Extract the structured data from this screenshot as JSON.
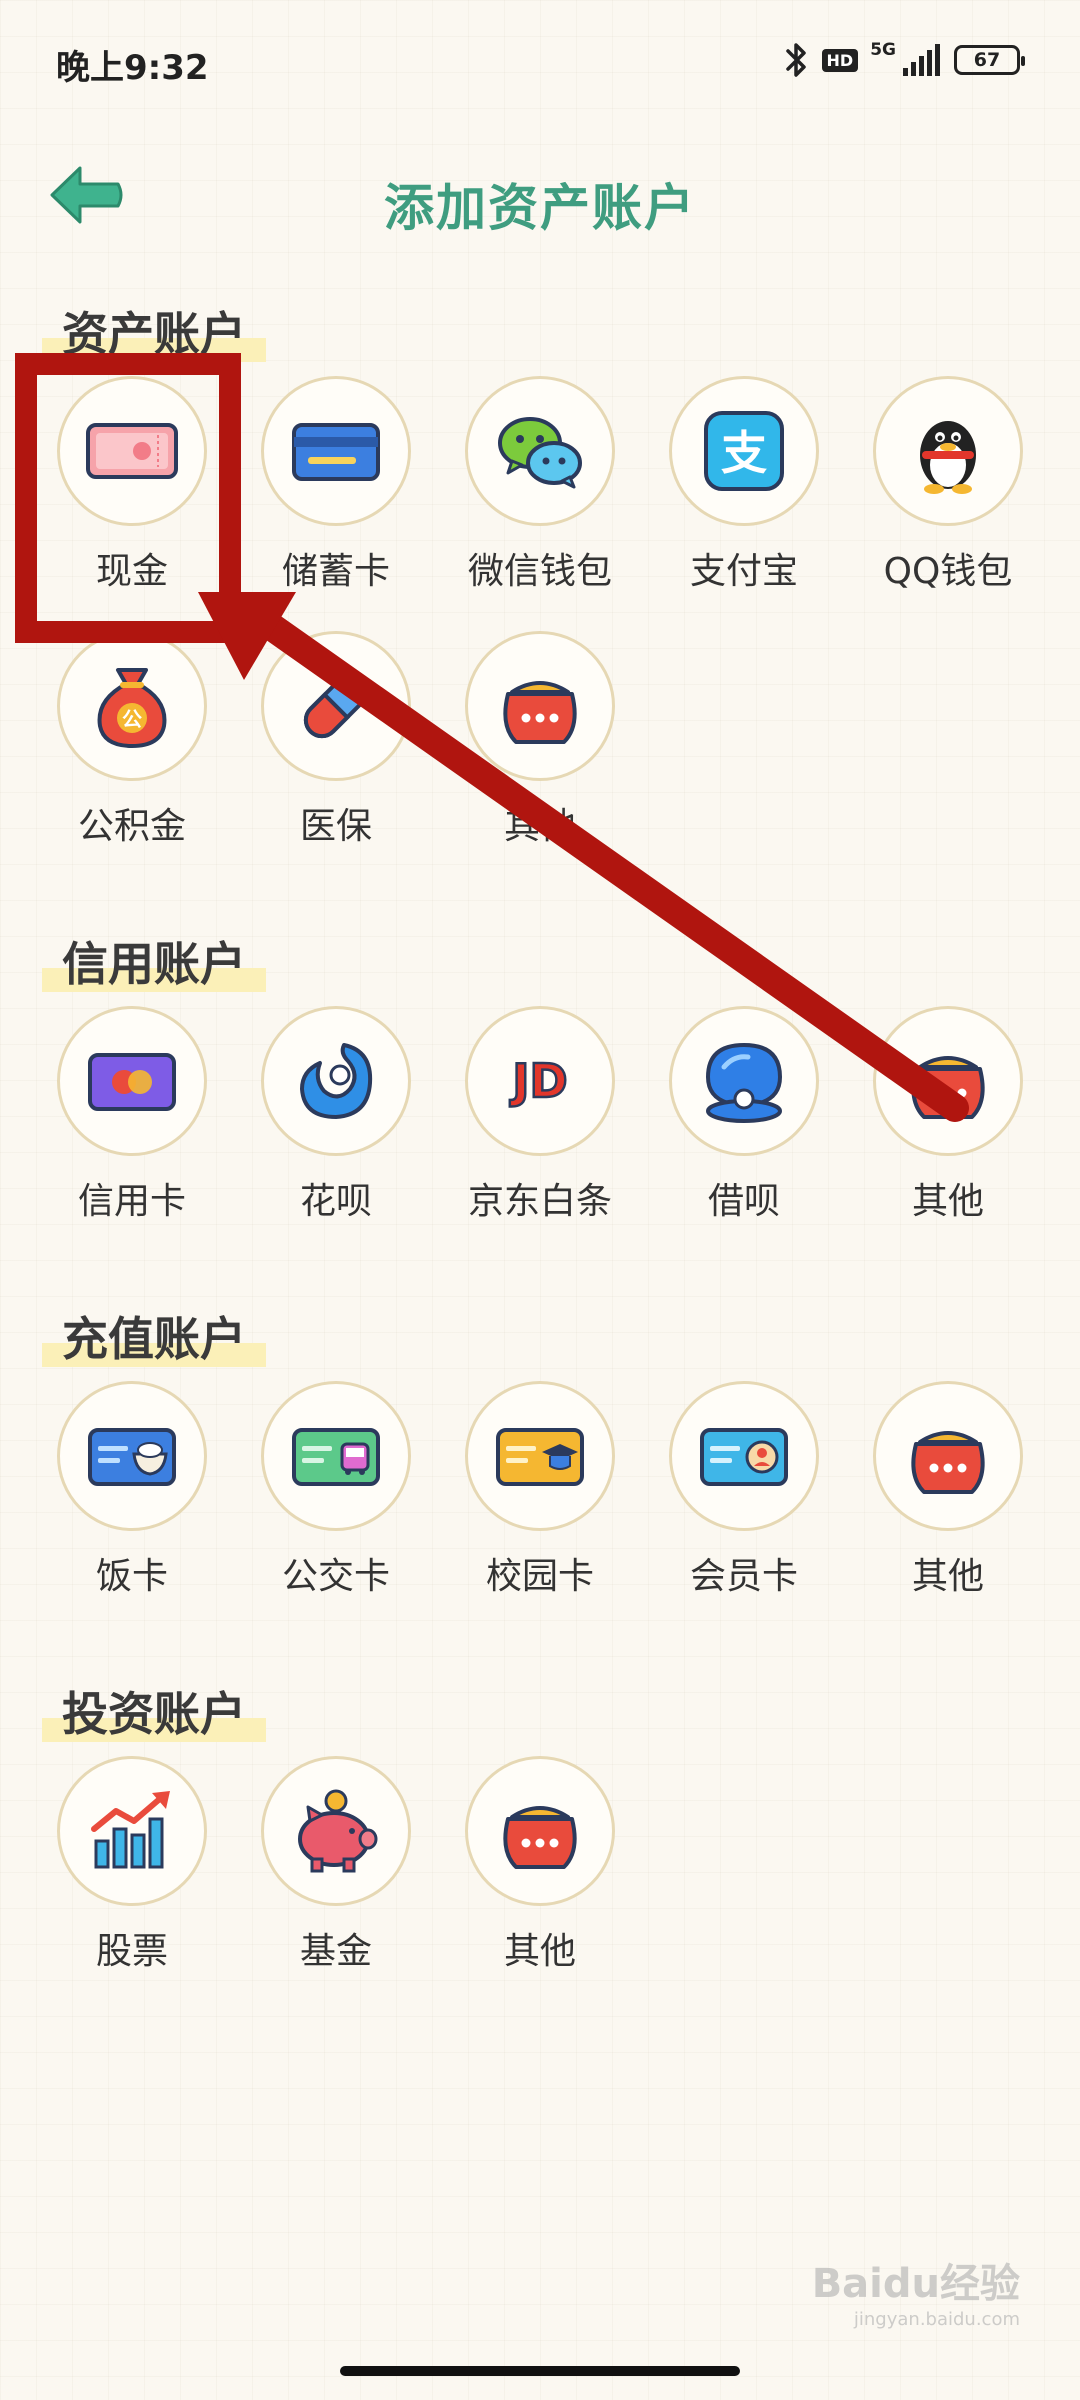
{
  "status_bar": {
    "time": "晚上9:32",
    "hd": "HD",
    "network": "5G",
    "battery": "67"
  },
  "header": {
    "title": "添加资产账户",
    "back_icon": "back-arrow-icon"
  },
  "sections": [
    {
      "title": "资产账户",
      "items": [
        {
          "label": "现金",
          "icon": "cash-icon"
        },
        {
          "label": "储蓄卡",
          "icon": "debit-card-icon"
        },
        {
          "label": "微信钱包",
          "icon": "wechat-icon"
        },
        {
          "label": "支付宝",
          "icon": "alipay-icon"
        },
        {
          "label": "QQ钱包",
          "icon": "qq-penguin-icon"
        },
        {
          "label": "公积金",
          "icon": "money-bag-icon"
        },
        {
          "label": "医保",
          "icon": "pill-icon"
        },
        {
          "label": "其他",
          "icon": "purse-icon"
        }
      ]
    },
    {
      "title": "信用账户",
      "items": [
        {
          "label": "信用卡",
          "icon": "credit-card-icon"
        },
        {
          "label": "花呗",
          "icon": "huabei-icon"
        },
        {
          "label": "京东白条",
          "icon": "jd-icon"
        },
        {
          "label": "借呗",
          "icon": "jiebei-icon"
        },
        {
          "label": "其他",
          "icon": "purse-icon"
        }
      ]
    },
    {
      "title": "充值账户",
      "items": [
        {
          "label": "饭卡",
          "icon": "meal-card-icon"
        },
        {
          "label": "公交卡",
          "icon": "bus-card-icon"
        },
        {
          "label": "校园卡",
          "icon": "campus-card-icon"
        },
        {
          "label": "会员卡",
          "icon": "member-card-icon"
        },
        {
          "label": "其他",
          "icon": "purse-icon"
        }
      ]
    },
    {
      "title": "投资账户",
      "items": [
        {
          "label": "股票",
          "icon": "stock-chart-icon"
        },
        {
          "label": "基金",
          "icon": "piggy-bank-icon"
        },
        {
          "label": "其他",
          "icon": "purse-icon"
        }
      ]
    }
  ],
  "colors": {
    "title_green": "#3f9d80",
    "annotation_red": "#b0150f",
    "section_highlight": "#fbf0b8"
  },
  "watermark": {
    "brand": "Baidu经验",
    "url": "jingyan.baidu.com"
  }
}
